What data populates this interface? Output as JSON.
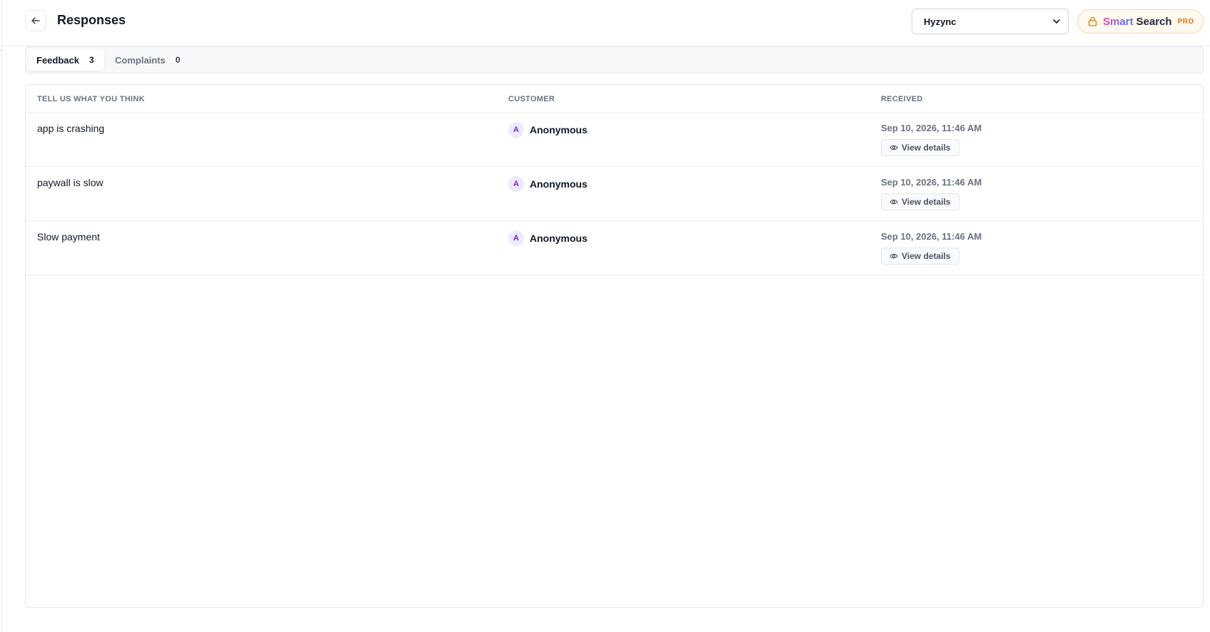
{
  "header": {
    "title": "Responses",
    "project_select": {
      "selected": "Hyzync"
    },
    "smart_search": {
      "word1": "Smart",
      "word2": "Search",
      "badge": "PRO"
    }
  },
  "tabs": [
    {
      "label": "Feedback",
      "count": "3",
      "active": true
    },
    {
      "label": "Complaints",
      "count": "0",
      "active": false
    }
  ],
  "table": {
    "columns": [
      "TELL US WHAT YOU THINK",
      "CUSTOMER",
      "RECEIVED"
    ],
    "rows": [
      {
        "feedback": "app is crashing",
        "avatar": "A",
        "customer": "Anonymous",
        "received": "Sep 10, 2026, 11:46 AM",
        "action": "View details"
      },
      {
        "feedback": "paywall is slow",
        "avatar": "A",
        "customer": "Anonymous",
        "received": "Sep 10, 2026, 11:46 AM",
        "action": "View details"
      },
      {
        "feedback": "Slow payment",
        "avatar": "A",
        "customer": "Anonymous",
        "received": "Sep 10, 2026, 11:46 AM",
        "action": "View details"
      }
    ]
  },
  "colors": {
    "accent_purple": "#6d28d9",
    "avatar_bg": "#ede9fe",
    "pro_orange": "#d97706",
    "smart_border": "#f4d6a6"
  },
  "icons": {
    "back": "arrow-left-icon",
    "lock": "lock-icon",
    "eye": "eye-icon",
    "dropdown": "chevron-down-icon"
  }
}
